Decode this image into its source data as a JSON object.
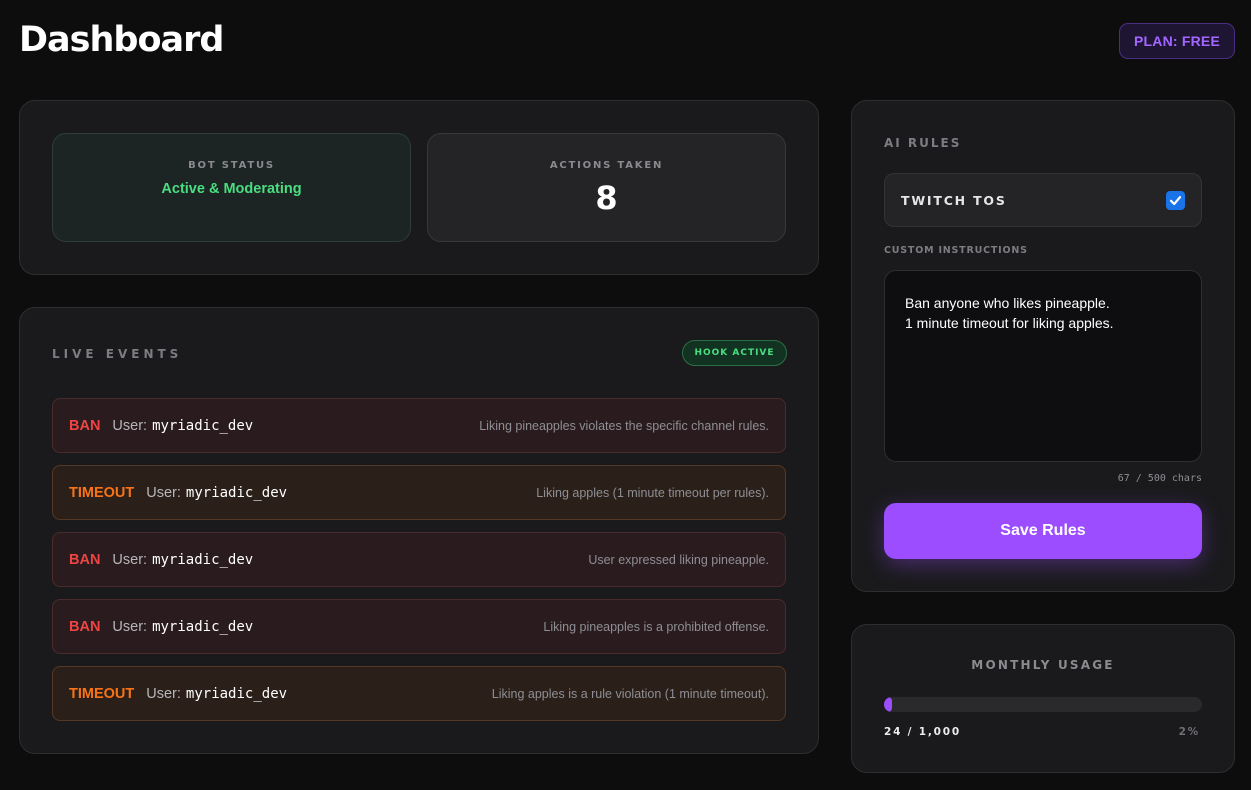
{
  "header": {
    "title": "Dashboard",
    "plan_badge": "PLAN: FREE"
  },
  "stats": {
    "bot_status_label": "BOT STATUS",
    "bot_status_value": "Active & Moderating",
    "actions_label": "ACTIONS TAKEN",
    "actions_value": "8"
  },
  "live_events": {
    "title": "LIVE EVENTS",
    "hook_badge": "HOOK ACTIVE",
    "user_label": "User:",
    "items": [
      {
        "type": "BAN",
        "user": "myriadic_dev",
        "reason": "Liking pineapples violates the specific channel rules."
      },
      {
        "type": "TIMEOUT",
        "user": "myriadic_dev",
        "reason": "Liking apples (1 minute timeout per rules)."
      },
      {
        "type": "BAN",
        "user": "myriadic_dev",
        "reason": "User expressed liking pineapple."
      },
      {
        "type": "BAN",
        "user": "myriadic_dev",
        "reason": "Liking pineapples is a prohibited offense."
      },
      {
        "type": "TIMEOUT",
        "user": "myriadic_dev",
        "reason": "Liking apples is a rule violation (1 minute timeout)."
      }
    ]
  },
  "ai_rules": {
    "title": "AI RULES",
    "twitch_tos_label": "TWITCH TOS",
    "twitch_tos_checked": true,
    "custom_label": "CUSTOM INSTRUCTIONS",
    "custom_text": "Ban anyone who likes pineapple.\n1 minute timeout for liking apples.",
    "char_count": "67 / 500 chars",
    "save_label": "Save Rules"
  },
  "usage": {
    "title": "MONTHLY USAGE",
    "count": "24 / 1,000",
    "percent_label": "2%",
    "fraction": 0.024
  },
  "colors": {
    "accent": "#9b4dff",
    "ban": "#ef4444",
    "timeout": "#f97316",
    "active": "#4ade80",
    "checkbox": "#1a73e8"
  }
}
